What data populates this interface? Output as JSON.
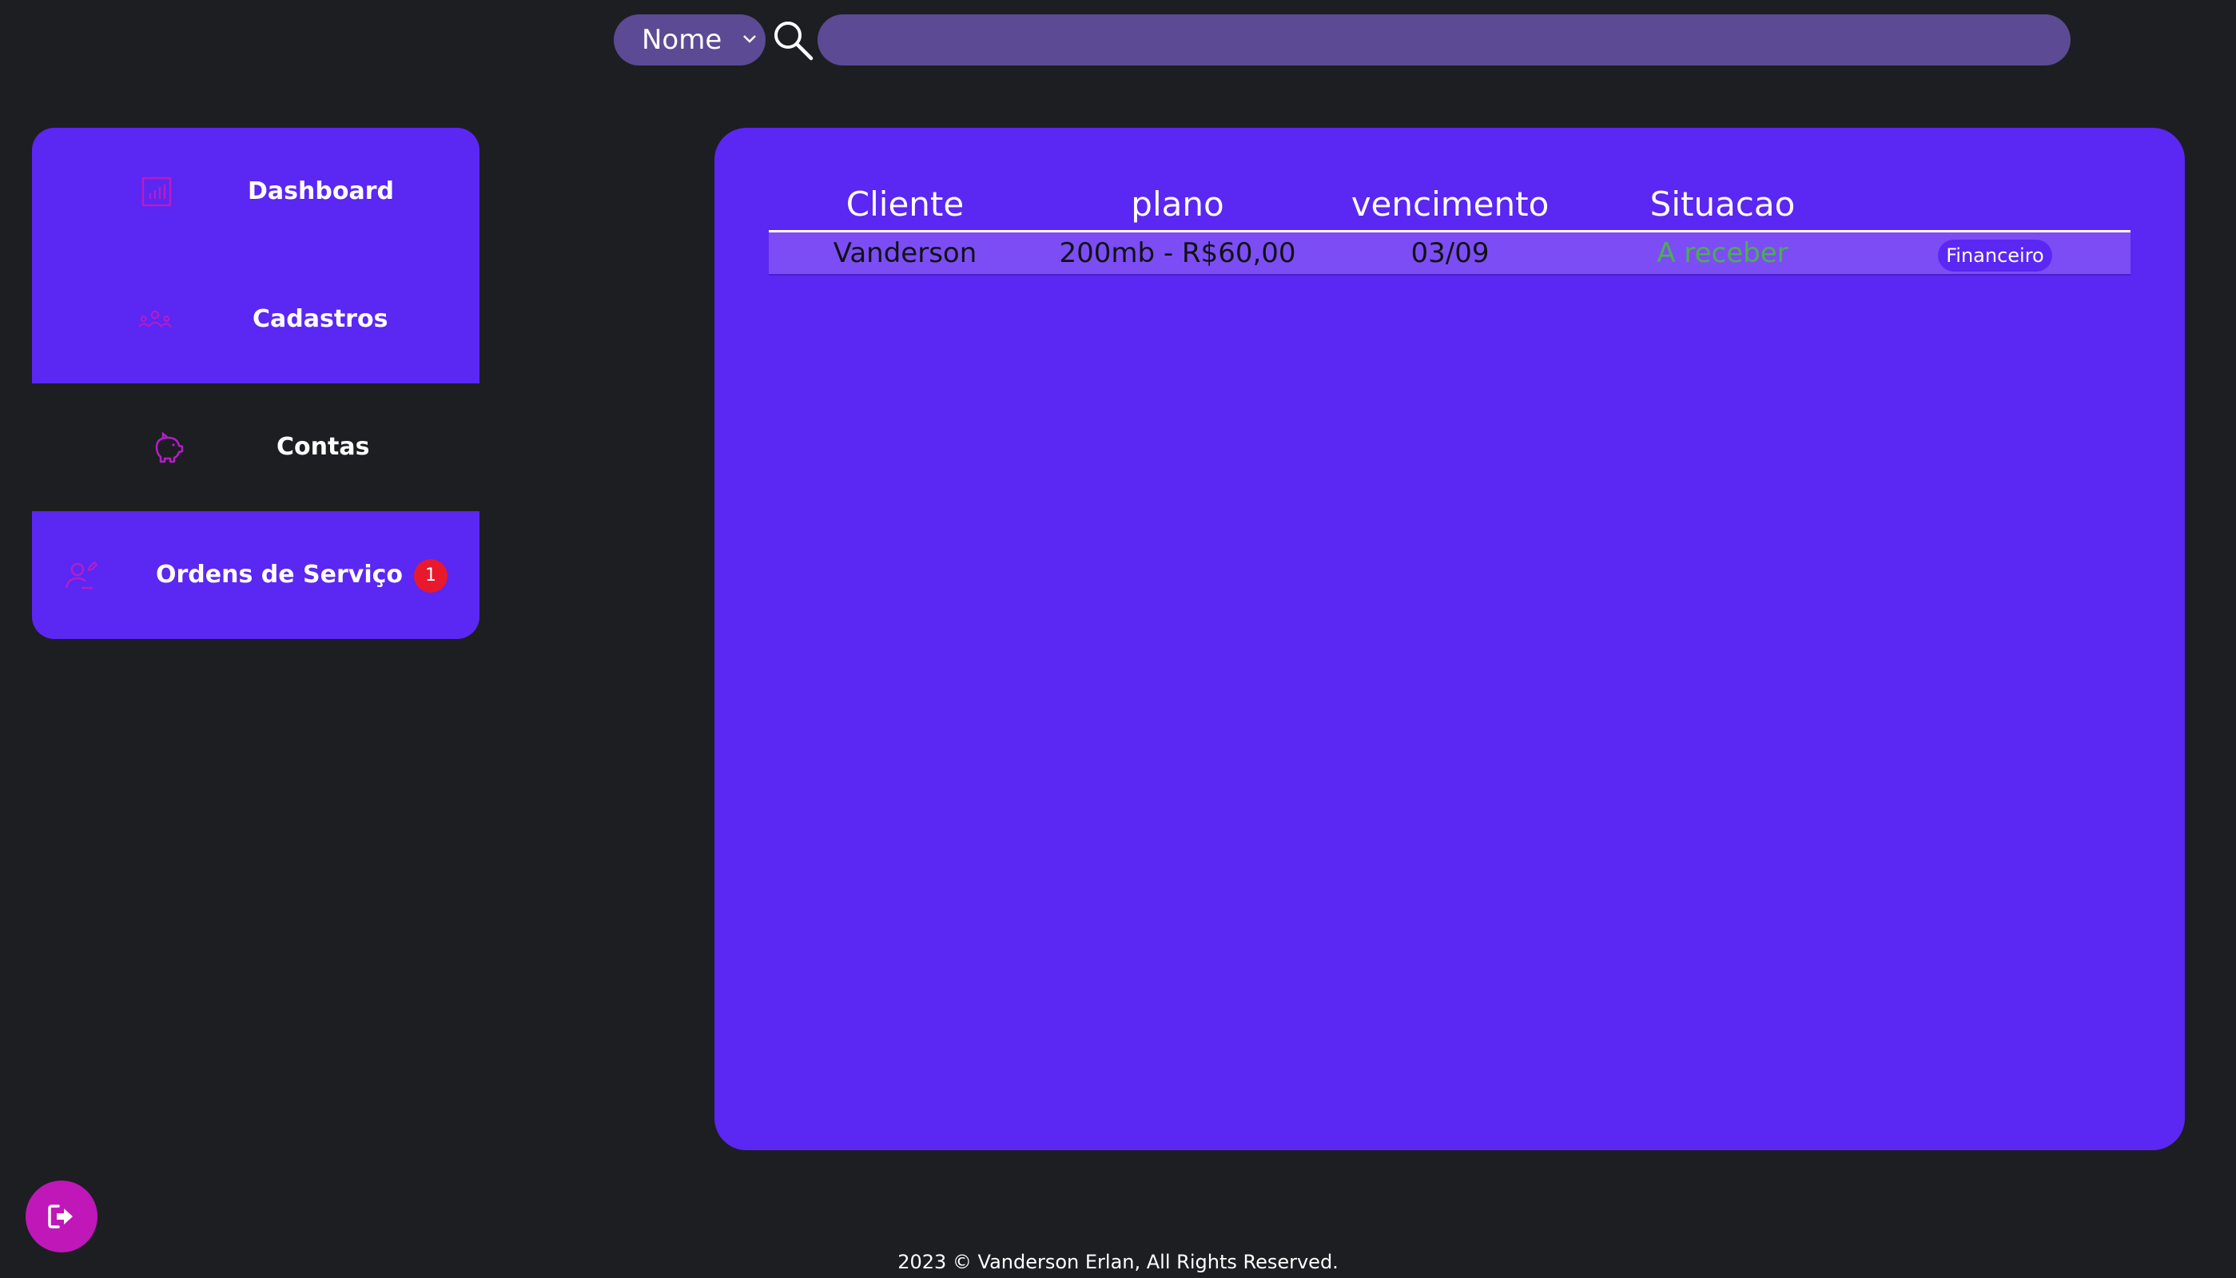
{
  "search": {
    "filter_value": "Nome",
    "placeholder": ""
  },
  "sidebar": {
    "items": [
      {
        "label": "Dashboard",
        "icon": "chart-icon"
      },
      {
        "label": "Cadastros",
        "icon": "users-icon"
      },
      {
        "label": "Contas",
        "icon": "piggy-bank-icon"
      },
      {
        "label": "Ordens de Serviço",
        "icon": "user-edit-icon",
        "badge": "1"
      }
    ]
  },
  "table": {
    "headers": [
      "Cliente",
      "plano",
      "vencimento",
      "Situacao"
    ],
    "rows": [
      {
        "cliente": "Vanderson",
        "plano": "200mb - R$60,00",
        "vencimento": "03/09",
        "situacao": "A receber",
        "action_label": "Financeiro"
      }
    ]
  },
  "footer": {
    "text": "2023 © Vanderson Erlan, All Rights Reserved."
  },
  "colors": {
    "background": "#1d1e22",
    "accent": "#5b27f2",
    "search_bg": "#5c4a94",
    "icon_magenta": "#c017b8",
    "status_green": "#4caf50",
    "badge_red": "#e8192c"
  }
}
